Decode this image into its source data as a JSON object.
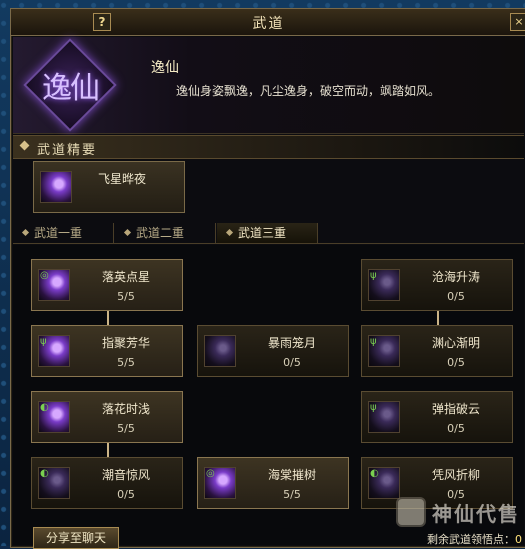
{
  "window": {
    "title": "武道",
    "help_label": "?",
    "close_label": "×"
  },
  "header": {
    "emblem_text": "逸仙",
    "style_name": "逸仙",
    "description": "逸仙身姿飘逸，凡尘逸身，破空而动，飒踏如风。"
  },
  "essence": {
    "section_label": "武道精要",
    "card_name": "飞星晔夜"
  },
  "tabs": [
    {
      "label": "武道一重",
      "active": false
    },
    {
      "label": "武道二重",
      "active": false
    },
    {
      "label": "武道三重",
      "active": true
    }
  ],
  "nodes": {
    "n1": {
      "name": "落英点星",
      "level": "5/5"
    },
    "n2": {
      "name": "指聚芳华",
      "level": "5/5"
    },
    "n3": {
      "name": "落花时浅",
      "level": "5/5"
    },
    "n4": {
      "name": "潮音惊风",
      "level": "0/5"
    },
    "m1": {
      "name": "暴雨笼月",
      "level": "0/5"
    },
    "m2": {
      "name": "海棠摧树",
      "level": "5/5"
    },
    "r1": {
      "name": "沧海升涛",
      "level": "0/5"
    },
    "r2": {
      "name": "渊心渐明",
      "level": "0/5"
    },
    "r3": {
      "name": "弹指破云",
      "level": "0/5"
    },
    "r4": {
      "name": "凭风折柳",
      "level": "0/5"
    }
  },
  "footer": {
    "share_label": "分享至聊天",
    "points_label": "剩余武道领悟点：",
    "points_value": "0"
  },
  "watermark": {
    "text": "神仙代售"
  },
  "colors": {
    "accent_gold": "#d6c08a",
    "title_text": "#f2e2b8",
    "points_value": "#ffe27a",
    "icon_purple": "#7a3cc8"
  },
  "icons": {
    "essence": "purple-comet-icon",
    "skill": "purple-slash-icon"
  }
}
